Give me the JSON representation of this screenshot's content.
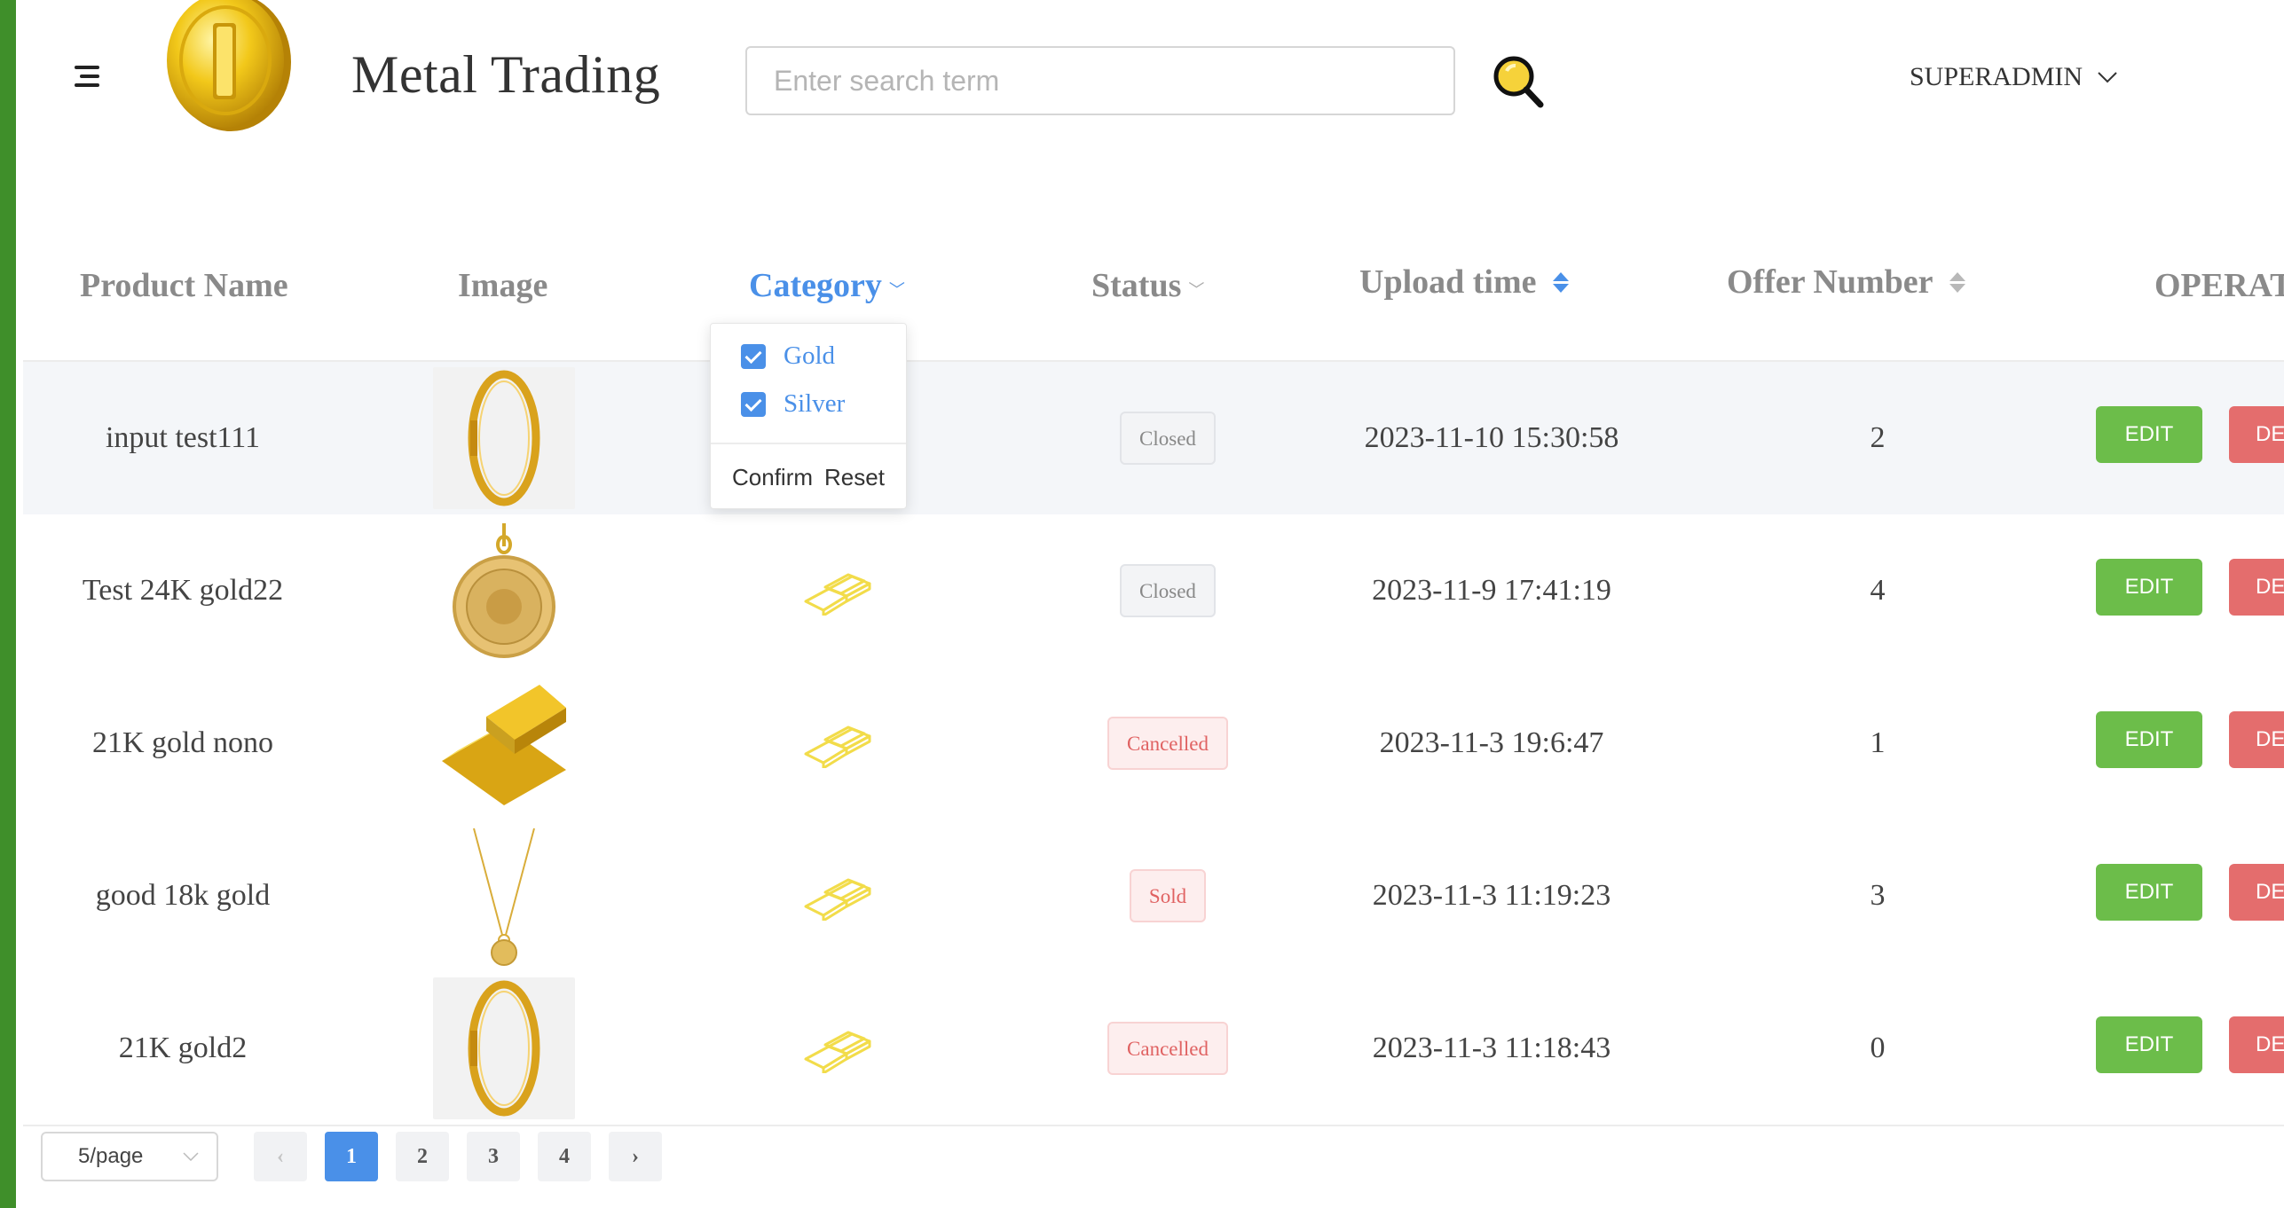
{
  "header": {
    "title": "Metal Trading",
    "search_placeholder": "Enter search term",
    "user": "SUPERADMIN"
  },
  "table": {
    "columns": {
      "name": "Product Name",
      "image": "Image",
      "category": "Category",
      "status": "Status",
      "upload_time": "Upload time",
      "offer_number": "Offer Number",
      "operation": "OPERATION"
    },
    "rows": [
      {
        "name": "input test111",
        "status": "Closed",
        "time": "2023-11-10 15:30:58",
        "offer": "2"
      },
      {
        "name": "Test 24K gold22",
        "status": "Closed",
        "time": "2023-11-9 17:41:19",
        "offer": "4"
      },
      {
        "name": "21K gold nono",
        "status": "Cancelled",
        "time": "2023-11-3 19:6:47",
        "offer": "1"
      },
      {
        "name": "good 18k gold",
        "status": "Sold",
        "time": "2023-11-3 11:19:23",
        "offer": "3"
      },
      {
        "name": "21K gold2",
        "status": "Cancelled",
        "time": "2023-11-3 11:18:43",
        "offer": "0"
      }
    ],
    "edit_label": "EDIT",
    "delete_label": "DEL"
  },
  "category_filter": {
    "options": [
      "Gold",
      "Silver"
    ],
    "confirm": "Confirm",
    "reset": "Reset"
  },
  "pagination": {
    "page_size": "5/page",
    "pages": [
      "1",
      "2",
      "3",
      "4"
    ],
    "current": "1",
    "prev": "‹",
    "next": "›"
  },
  "colors": {
    "sidebar_accent": "#3f8f2a",
    "active_blue": "#4a90e8",
    "edit_green": "#6cbd4a",
    "delete_red": "#e46d6d",
    "gold": "#f2dc4a"
  }
}
